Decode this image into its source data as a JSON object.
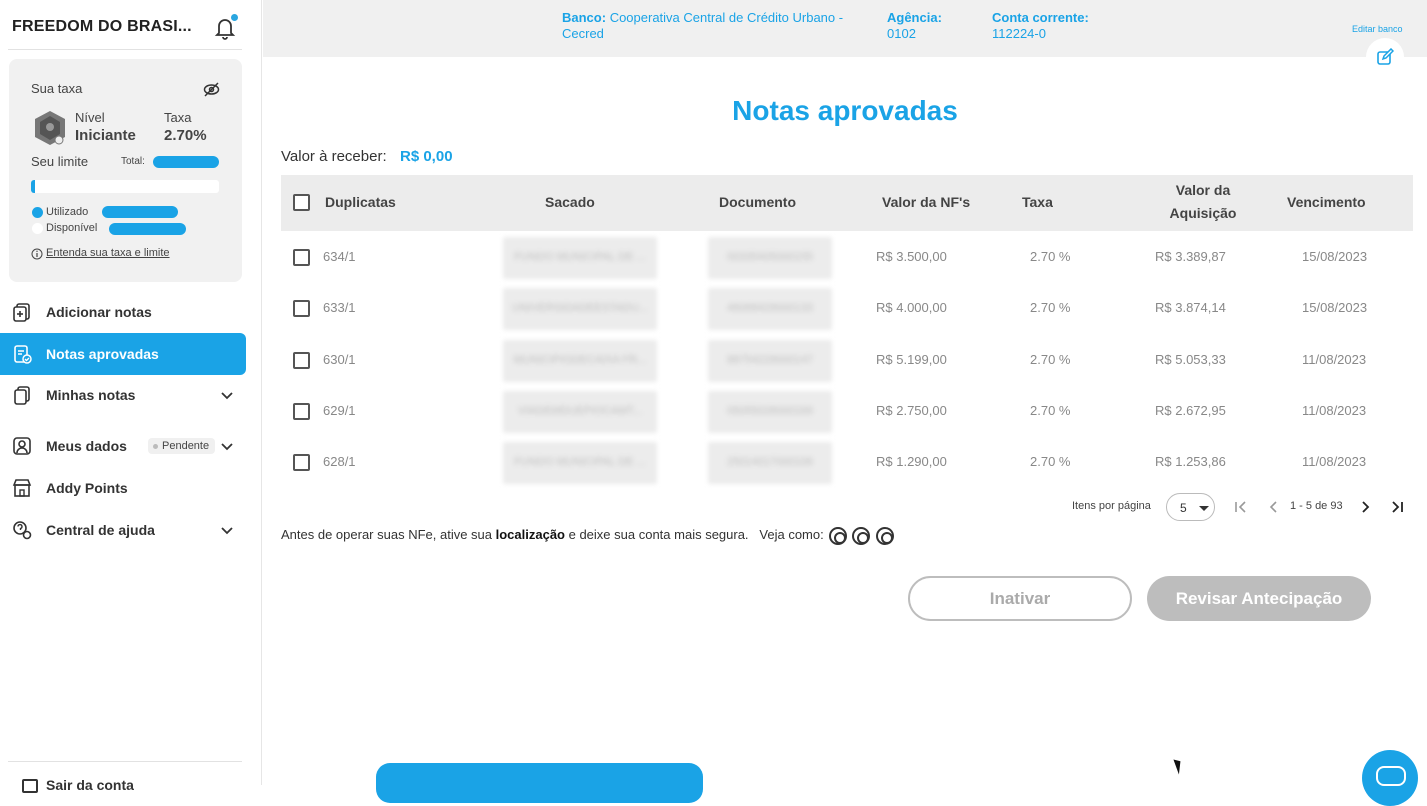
{
  "app": {
    "brand": "FREEDOM DO BRASI..."
  },
  "rate_card": {
    "title": "Sua taxa",
    "nivel_label": "Nível",
    "nivel_value": "Iniciante",
    "taxa_label": "Taxa",
    "taxa_value": "2.70%",
    "limite_label": "Seu limite",
    "total_label": "Total:",
    "progress_used_fraction": 0.02,
    "legend_used": "Utilizado",
    "legend_available": "Disponível",
    "info_link": "Entenda sua taxa e limite"
  },
  "nav": {
    "items": [
      {
        "label": "Adicionar notas",
        "icon": "add-document-icon"
      },
      {
        "label": "Notas aprovadas",
        "icon": "approved-notes-icon",
        "active": true
      },
      {
        "label": "Minhas notas",
        "icon": "documents-icon"
      },
      {
        "label": "Meus dados",
        "icon": "user-id-icon",
        "badge": "Pendente"
      },
      {
        "label": "Addy Points",
        "icon": "store-icon"
      },
      {
        "label": "Central de ajuda",
        "icon": "help-icon"
      }
    ],
    "logout": "Sair da conta"
  },
  "bank": {
    "banco_label": "Banco:",
    "banco_value": "Cooperativa Central de Crédito Urbano - Cecred",
    "agencia_label": "Agência:",
    "agencia_value": "0102",
    "conta_label": "Conta corrente:",
    "conta_value": "112224-0",
    "edit_label": "Editar banco"
  },
  "main": {
    "title": "Notas aprovadas",
    "valor_label": "Valor à receber:",
    "valor_value": "R$ 0,00"
  },
  "table": {
    "headers": {
      "duplicatas": "Duplicatas",
      "sacado": "Sacado",
      "documento": "Documento",
      "valor_nf": "Valor da NF's",
      "taxa": "Taxa",
      "valor_aquisicao_1": "Valor da",
      "valor_aquisicao_2": "Aquisição",
      "vencimento": "Vencimento"
    },
    "rows": [
      {
        "duplicata": "634/1",
        "sacado": "FUNDO MUNICIPAL DE ...",
        "documento": "00335405000155",
        "valor_nf": "R$ 3.500,00",
        "taxa": "2.70 %",
        "valor_aquisicao": "R$ 3.389,87",
        "vencimento": "15/08/2023"
      },
      {
        "duplicata": "633/1",
        "sacado": "UNIVERSIDADEESTADU...",
        "documento": "46068429000133",
        "valor_nf": "R$ 4.000,00",
        "taxa": "2.70 %",
        "valor_aquisicao": "R$ 3.874,14",
        "vencimento": "15/08/2023"
      },
      {
        "duplicata": "630/1",
        "sacado": "MUNICIPIODECAIXA FR...",
        "documento": "88754229000147",
        "valor_nf": "R$ 5.199,00",
        "taxa": "2.70 %",
        "valor_aquisicao": "R$ 5.053,33",
        "vencimento": "11/08/2023"
      },
      {
        "duplicata": "629/1",
        "sacado": "VIAGEMDUEPIOCAMT...",
        "documento": "05055028000169",
        "valor_nf": "R$ 2.750,00",
        "taxa": "2.70 %",
        "valor_aquisicao": "R$ 2.672,95",
        "vencimento": "11/08/2023"
      },
      {
        "duplicata": "628/1",
        "sacado": "FUNDO MUNICIPAL DE ...",
        "documento": "25014017000106",
        "valor_nf": "R$ 1.290,00",
        "taxa": "2.70 %",
        "valor_aquisicao": "R$ 1.253,86",
        "vencimento": "11/08/2023"
      }
    ]
  },
  "pager": {
    "items_label": "Itens por página",
    "per_page": "5",
    "range": "1 - 5 de 93"
  },
  "notice": {
    "text_before": "Antes de operar suas NFe, ative sua ",
    "bold": "localização",
    "text_after": " e deixe sua conta mais segura.",
    "veja": "Veja como:"
  },
  "actions": {
    "inativar": "Inativar",
    "revisar": "Revisar Antecipação"
  },
  "colors": {
    "accent": "#1aa3e6",
    "disabled": "#bdbdbd"
  }
}
